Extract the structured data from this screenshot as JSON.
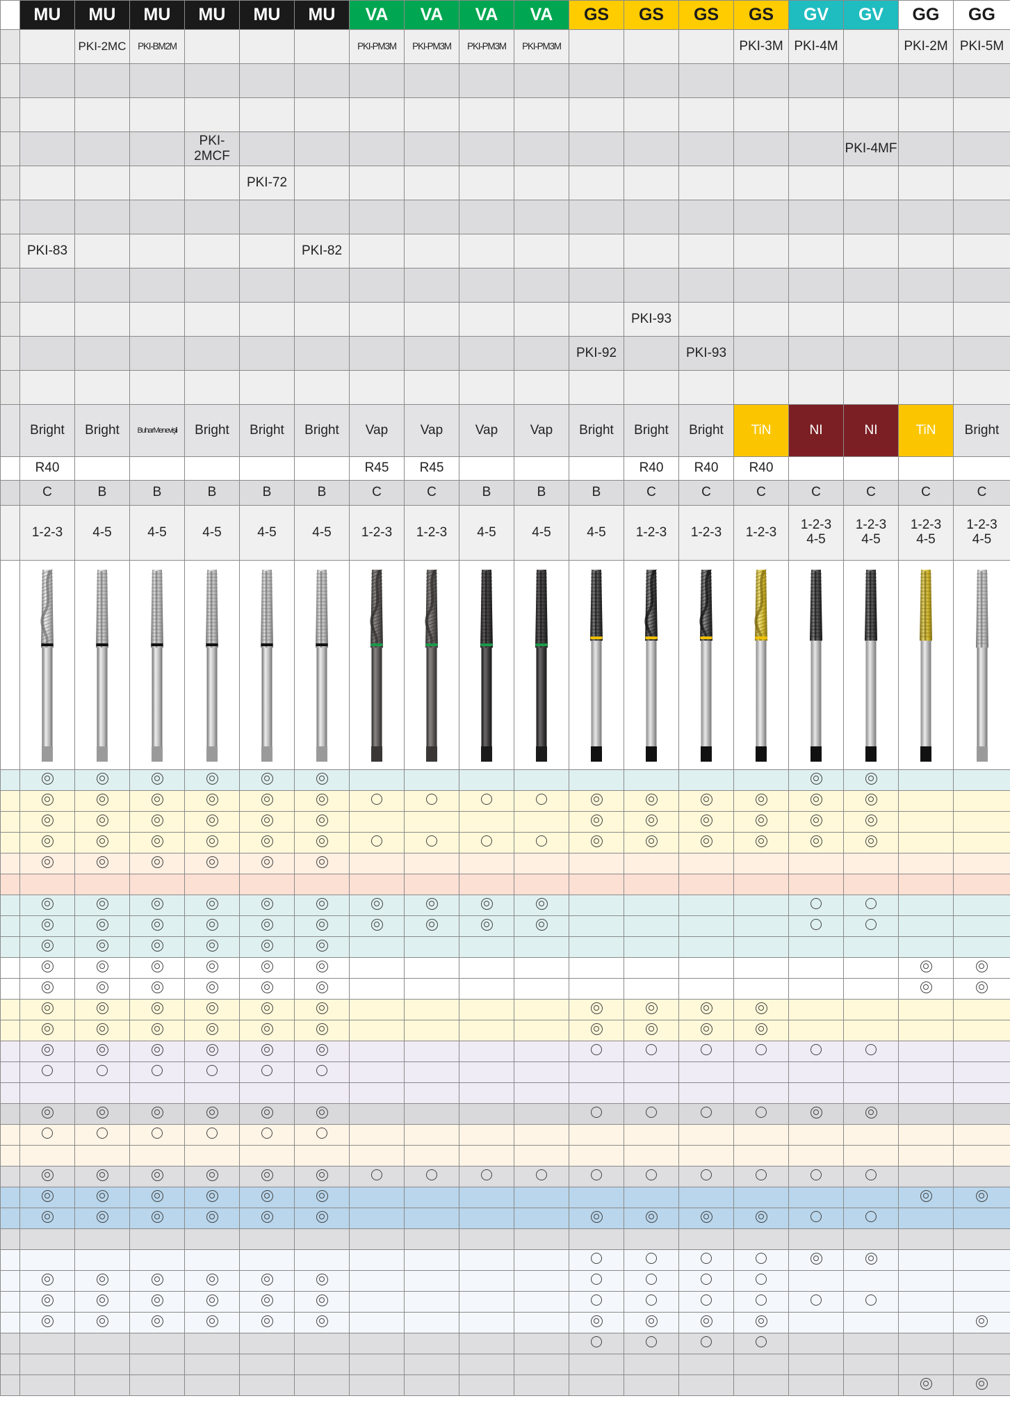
{
  "headers": [
    {
      "label": "MU",
      "group": "mu"
    },
    {
      "label": "MU",
      "group": "mu"
    },
    {
      "label": "MU",
      "group": "mu"
    },
    {
      "label": "MU",
      "group": "mu"
    },
    {
      "label": "MU",
      "group": "mu"
    },
    {
      "label": "MU",
      "group": "mu"
    },
    {
      "label": "VA",
      "group": "va"
    },
    {
      "label": "VA",
      "group": "va"
    },
    {
      "label": "VA",
      "group": "va"
    },
    {
      "label": "VA",
      "group": "va"
    },
    {
      "label": "GS",
      "group": "gs"
    },
    {
      "label": "GS",
      "group": "gs"
    },
    {
      "label": "GS",
      "group": "gs"
    },
    {
      "label": "GS",
      "group": "gs"
    },
    {
      "label": "GV",
      "group": "gv"
    },
    {
      "label": "GV",
      "group": "gv"
    },
    {
      "label": "GG",
      "group": "gg"
    },
    {
      "label": "GG",
      "group": "gg"
    }
  ],
  "group_colors": {
    "mu": "#1a1a1a",
    "va": "#00a651",
    "gs": "#ffcc00",
    "gv": "#1fbcc0",
    "gg": "#ffffff"
  },
  "code_rows": [
    [
      "",
      "PKI-2MC",
      "PKI-BM2M",
      "",
      "",
      "",
      "PKI-PM3M",
      "PKI-PM3M",
      "PKI-PM3M",
      "PKI-PM3M",
      "",
      "",
      "",
      "PKI-3M",
      "PKI-4M",
      "",
      "PKI-2M",
      "PKI-5M"
    ],
    [
      "",
      "",
      "",
      "",
      "",
      "",
      "",
      "",
      "",
      "",
      "",
      "",
      "",
      "",
      "",
      "",
      "",
      ""
    ],
    [
      "",
      "",
      "",
      "",
      "",
      "",
      "",
      "",
      "",
      "",
      "",
      "",
      "",
      "",
      "",
      "",
      "",
      ""
    ],
    [
      "",
      "",
      "",
      "PKI-2MCF",
      "",
      "",
      "",
      "",
      "",
      "",
      "",
      "",
      "",
      "",
      "",
      "PKI-4MF",
      "",
      ""
    ],
    [
      "",
      "",
      "",
      "",
      "PKI-72",
      "",
      "",
      "",
      "",
      "",
      "",
      "",
      "",
      "",
      "",
      "",
      "",
      ""
    ],
    [
      "",
      "",
      "",
      "",
      "",
      "",
      "",
      "",
      "",
      "",
      "",
      "",
      "",
      "",
      "",
      "",
      "",
      ""
    ],
    [
      "PKI-83",
      "",
      "",
      "",
      "",
      "PKI-82",
      "",
      "",
      "",
      "",
      "",
      "",
      "",
      "",
      "",
      "",
      "",
      ""
    ],
    [
      "",
      "",
      "",
      "",
      "",
      "",
      "",
      "",
      "",
      "",
      "",
      "",
      "",
      "",
      "",
      "",
      "",
      ""
    ],
    [
      "",
      "",
      "",
      "",
      "",
      "",
      "",
      "",
      "",
      "",
      "",
      "PKI-93",
      "",
      "",
      "",
      "",
      "",
      ""
    ],
    [
      "",
      "",
      "",
      "",
      "",
      "",
      "",
      "",
      "",
      "",
      "PKI-92",
      "",
      "PKI-93",
      "",
      "",
      "",
      "",
      ""
    ],
    [
      "",
      "",
      "",
      "",
      "",
      "",
      "",
      "",
      "",
      "",
      "",
      "",
      "",
      "",
      "",
      "",
      "",
      ""
    ]
  ],
  "coatings": [
    "Bright",
    "Bright",
    "BuharMenevişli",
    "Bright",
    "Bright",
    "Bright",
    "Vap",
    "Vap",
    "Vap",
    "Vap",
    "Bright",
    "Bright",
    "Bright",
    "TiN",
    "NI",
    "NI",
    "TiN",
    "Bright"
  ],
  "helix": [
    "R40",
    "",
    "",
    "",
    "",
    "",
    "R45",
    "R45",
    "",
    "",
    "",
    "R40",
    "R40",
    "R40",
    "",
    "",
    "",
    ""
  ],
  "chamfer": [
    "C",
    "B",
    "B",
    "B",
    "B",
    "B",
    "C",
    "C",
    "B",
    "B",
    "B",
    "C",
    "C",
    "C",
    "C",
    "C",
    "C",
    "C"
  ],
  "thread_lengths": [
    "1-2-3",
    "4-5",
    "4-5",
    "4-5",
    "4-5",
    "4-5",
    "1-2-3",
    "1-2-3",
    "4-5",
    "4-5",
    "4-5",
    "1-2-3",
    "1-2-3",
    "1-2-3",
    "1-2-3\n4-5",
    "1-2-3\n4-5",
    "1-2-3\n4-5",
    "1-2-3\n4-5"
  ],
  "tool_images": [
    {
      "icon": "spiral-flute-tap-icon",
      "finish": "bright",
      "ring": "black"
    },
    {
      "icon": "straight-flute-tap-icon",
      "finish": "bright",
      "ring": "black"
    },
    {
      "icon": "straight-flute-tap-icon",
      "finish": "bright",
      "ring": "black"
    },
    {
      "icon": "straight-flute-tap-icon",
      "finish": "bright",
      "ring": "black"
    },
    {
      "icon": "straight-flute-tap-icon",
      "finish": "bright",
      "ring": "black"
    },
    {
      "icon": "straight-flute-tap-icon",
      "finish": "bright",
      "ring": "black"
    },
    {
      "icon": "spiral-flute-tap-icon",
      "finish": "vap",
      "ring": "green"
    },
    {
      "icon": "spiral-flute-tap-icon",
      "finish": "vap",
      "ring": "green"
    },
    {
      "icon": "straight-flute-tap-icon",
      "finish": "vap-dark",
      "ring": "green"
    },
    {
      "icon": "straight-flute-tap-icon",
      "finish": "vap-dark",
      "ring": "green"
    },
    {
      "icon": "spiral-point-tap-icon",
      "finish": "dark",
      "ring": "yellow"
    },
    {
      "icon": "spiral-flute-tap-icon",
      "finish": "dark",
      "ring": "yellow"
    },
    {
      "icon": "spiral-flute-tap-icon",
      "finish": "dark",
      "ring": "yellow"
    },
    {
      "icon": "spiral-flute-tap-icon",
      "finish": "tin",
      "ring": "yellow"
    },
    {
      "icon": "straight-flute-tap-icon",
      "finish": "dark",
      "ring": "none"
    },
    {
      "icon": "straight-flute-tap-icon",
      "finish": "dark",
      "ring": "none"
    },
    {
      "icon": "straight-flute-tap-icon",
      "finish": "tin",
      "ring": "none"
    },
    {
      "icon": "straight-flute-tap-icon",
      "finish": "bright",
      "ring": "none"
    }
  ],
  "symbol_legend": {
    "oo": "◎",
    "o": "○"
  },
  "suitability_rows": [
    {
      "color": "blue",
      "cells": [
        "oo",
        "oo",
        "oo",
        "oo",
        "oo",
        "oo",
        "",
        "",
        "",
        "",
        "",
        "",
        "",
        "",
        "oo",
        "oo",
        "",
        ""
      ]
    },
    {
      "color": "yellow",
      "cells": [
        "oo",
        "oo",
        "oo",
        "oo",
        "oo",
        "oo",
        "o",
        "o",
        "o",
        "o",
        "oo",
        "oo",
        "oo",
        "oo",
        "oo",
        "oo",
        "",
        ""
      ]
    },
    {
      "color": "yellow",
      "cells": [
        "oo",
        "oo",
        "oo",
        "oo",
        "oo",
        "oo",
        "",
        "",
        "",
        "",
        "oo",
        "oo",
        "oo",
        "oo",
        "oo",
        "oo",
        "",
        ""
      ]
    },
    {
      "color": "yellow",
      "cells": [
        "oo",
        "oo",
        "oo",
        "oo",
        "oo",
        "oo",
        "o",
        "o",
        "o",
        "o",
        "oo",
        "oo",
        "oo",
        "oo",
        "oo",
        "oo",
        "",
        ""
      ]
    },
    {
      "color": "peach",
      "cells": [
        "oo",
        "oo",
        "oo",
        "oo",
        "oo",
        "oo",
        "",
        "",
        "",
        "",
        "",
        "",
        "",
        "",
        "",
        "",
        "",
        ""
      ]
    },
    {
      "color": "salmon",
      "cells": [
        "",
        "",
        "",
        "",
        "",
        "",
        "",
        "",
        "",
        "",
        "",
        "",
        "",
        "",
        "",
        "",
        "",
        ""
      ]
    },
    {
      "color": "blue",
      "cells": [
        "oo",
        "oo",
        "oo",
        "oo",
        "oo",
        "oo",
        "oo",
        "oo",
        "oo",
        "oo",
        "",
        "",
        "",
        "",
        "o",
        "o",
        "",
        ""
      ]
    },
    {
      "color": "blue",
      "cells": [
        "oo",
        "oo",
        "oo",
        "oo",
        "oo",
        "oo",
        "oo",
        "oo",
        "oo",
        "oo",
        "",
        "",
        "",
        "",
        "o",
        "o",
        "",
        ""
      ]
    },
    {
      "color": "blue",
      "cells": [
        "oo",
        "oo",
        "oo",
        "oo",
        "oo",
        "oo",
        "",
        "",
        "",
        "",
        "",
        "",
        "",
        "",
        "",
        "",
        "",
        ""
      ]
    },
    {
      "color": "white",
      "cells": [
        "oo",
        "oo",
        "oo",
        "oo",
        "oo",
        "oo",
        "",
        "",
        "",
        "",
        "",
        "",
        "",
        "",
        "",
        "",
        "oo",
        "oo"
      ]
    },
    {
      "color": "white",
      "cells": [
        "oo",
        "oo",
        "oo",
        "oo",
        "oo",
        "oo",
        "",
        "",
        "",
        "",
        "",
        "",
        "",
        "",
        "",
        "",
        "oo",
        "oo"
      ]
    },
    {
      "color": "yellow",
      "cells": [
        "oo",
        "oo",
        "oo",
        "oo",
        "oo",
        "oo",
        "",
        "",
        "",
        "",
        "oo",
        "oo",
        "oo",
        "oo",
        "",
        "",
        "",
        ""
      ]
    },
    {
      "color": "yellow",
      "cells": [
        "oo",
        "oo",
        "oo",
        "oo",
        "oo",
        "oo",
        "",
        "",
        "",
        "",
        "oo",
        "oo",
        "oo",
        "oo",
        "",
        "",
        "",
        ""
      ]
    },
    {
      "color": "lav",
      "cells": [
        "oo",
        "oo",
        "oo",
        "oo",
        "oo",
        "oo",
        "",
        "",
        "",
        "",
        "o",
        "o",
        "o",
        "o",
        "o",
        "o",
        "",
        ""
      ]
    },
    {
      "color": "lav",
      "cells": [
        "o",
        "o",
        "o",
        "o",
        "o",
        "o",
        "",
        "",
        "",
        "",
        "",
        "",
        "",
        "",
        "",
        "",
        "",
        ""
      ]
    },
    {
      "color": "lav",
      "cells": [
        "",
        "",
        "",
        "",
        "",
        "",
        "",
        "",
        "",
        "",
        "",
        "",
        "",
        "",
        "",
        "",
        "",
        ""
      ]
    },
    {
      "color": "grey",
      "cells": [
        "oo",
        "oo",
        "oo",
        "oo",
        "oo",
        "oo",
        "",
        "",
        "",
        "",
        "o",
        "o",
        "o",
        "o",
        "oo",
        "oo",
        "",
        ""
      ]
    },
    {
      "color": "cream",
      "cells": [
        "o",
        "o",
        "o",
        "o",
        "o",
        "o",
        "",
        "",
        "",
        "",
        "",
        "",
        "",
        "",
        "",
        "",
        "",
        ""
      ]
    },
    {
      "color": "cream",
      "cells": [
        "",
        "",
        "",
        "",
        "",
        "",
        "",
        "",
        "",
        "",
        "",
        "",
        "",
        "",
        "",
        "",
        "",
        ""
      ]
    },
    {
      "color": "ltgrey",
      "cells": [
        "oo",
        "oo",
        "oo",
        "oo",
        "oo",
        "oo",
        "o",
        "o",
        "o",
        "o",
        "o",
        "o",
        "o",
        "o",
        "o",
        "o",
        "",
        ""
      ]
    },
    {
      "color": "sky",
      "cells": [
        "oo",
        "oo",
        "oo",
        "oo",
        "oo",
        "oo",
        "",
        "",
        "",
        "",
        "",
        "",
        "",
        "",
        "",
        "",
        "oo",
        "oo"
      ]
    },
    {
      "color": "sky",
      "cells": [
        "oo",
        "oo",
        "oo",
        "oo",
        "oo",
        "oo",
        "",
        "",
        "",
        "",
        "oo",
        "oo",
        "oo",
        "oo",
        "o",
        "o",
        "",
        ""
      ]
    },
    {
      "color": "ltgrey",
      "cells": [
        "",
        "",
        "",
        "",
        "",
        "",
        "",
        "",
        "",
        "",
        "",
        "",
        "",
        "",
        "",
        "",
        "",
        ""
      ]
    },
    {
      "color": "pale",
      "cells": [
        "",
        "",
        "",
        "",
        "",
        "",
        "",
        "",
        "",
        "",
        "o",
        "o",
        "o",
        "o",
        "oo",
        "oo",
        "",
        ""
      ]
    },
    {
      "color": "pale",
      "cells": [
        "oo",
        "oo",
        "oo",
        "oo",
        "oo",
        "oo",
        "",
        "",
        "",
        "",
        "o",
        "o",
        "o",
        "o",
        "",
        "",
        "",
        ""
      ]
    },
    {
      "color": "pale",
      "cells": [
        "oo",
        "oo",
        "oo",
        "oo",
        "oo",
        "oo",
        "",
        "",
        "",
        "",
        "o",
        "o",
        "o",
        "o",
        "o",
        "o",
        "",
        ""
      ]
    },
    {
      "color": "pale",
      "cells": [
        "oo",
        "oo",
        "oo",
        "oo",
        "oo",
        "oo",
        "",
        "",
        "",
        "",
        "oo",
        "oo",
        "oo",
        "oo",
        "",
        "",
        "",
        "oo"
      ]
    },
    {
      "color": "ltgrey",
      "cells": [
        "",
        "",
        "",
        "",
        "",
        "",
        "",
        "",
        "",
        "",
        "o",
        "o",
        "o",
        "o",
        "",
        "",
        "",
        ""
      ]
    },
    {
      "color": "ltgrey",
      "cells": [
        "",
        "",
        "",
        "",
        "",
        "",
        "",
        "",
        "",
        "",
        "",
        "",
        "",
        "",
        "",
        "",
        "",
        ""
      ]
    },
    {
      "color": "ltgrey",
      "cells": [
        "",
        "",
        "",
        "",
        "",
        "",
        "",
        "",
        "",
        "",
        "",
        "",
        "",
        "",
        "",
        "",
        "oo",
        "oo"
      ]
    }
  ]
}
